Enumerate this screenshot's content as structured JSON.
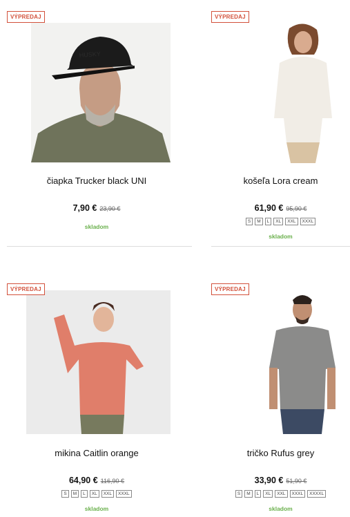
{
  "products": [
    {
      "badge": "VÝPREDAJ",
      "title": "čiapka Trucker black UNI",
      "price": "7,90 €",
      "old_price": "23,90 €",
      "sizes": [],
      "stock": "skladom"
    },
    {
      "badge": "VÝPREDAJ",
      "title": "košeľa Lora cream",
      "price": "61,90 €",
      "old_price": "95,90 €",
      "sizes": [
        "S",
        "M",
        "L",
        "XL",
        "XXL",
        "XXXL"
      ],
      "stock": "skladom"
    },
    {
      "badge": "VÝPREDAJ",
      "title": "mikina Caitlin orange",
      "price": "64,90 €",
      "old_price": "116,90 €",
      "sizes": [
        "S",
        "M",
        "L",
        "XL",
        "XXL",
        "XXXL"
      ],
      "stock": "skladom"
    },
    {
      "badge": "VÝPREDAJ",
      "title": "tričko Rufus grey",
      "price": "33,90 €",
      "old_price": "51,90 €",
      "sizes": [
        "S",
        "M",
        "L",
        "XL",
        "XXL",
        "XXXL",
        "XXXXL"
      ],
      "stock": "skladom"
    }
  ],
  "colors": {
    "badge": "#d2503a",
    "stock": "#6ab04c"
  },
  "product_images": [
    "man-in-black-cap-photo",
    "woman-in-cream-shirt-photo",
    "woman-in-orange-hoodie-photo",
    "man-in-grey-tshirt-photo"
  ]
}
